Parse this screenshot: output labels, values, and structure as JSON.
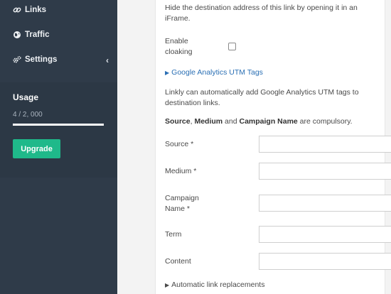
{
  "sidebar": {
    "nav": [
      {
        "label": "Links",
        "icon": "link-icon"
      },
      {
        "label": "Traffic",
        "icon": "globe-icon"
      },
      {
        "label": "Settings",
        "icon": "gears-icon"
      }
    ],
    "settings_chevron": "‹",
    "usage": {
      "title": "Usage",
      "count": "4 / 2, 000",
      "progress_fraction": 0.002
    },
    "upgrade_label": "Upgrade"
  },
  "form": {
    "hide_desc": "Hide the destination address of this link by opening it in an iFrame.",
    "cloaking_label": "Enable cloaking",
    "cloaking_checked": false,
    "utm_toggle": "Google Analytics UTM Tags",
    "utm_desc": "Linkly can automatically add Google Analytics UTM tags to destination links.",
    "compulsory": {
      "source": "Source",
      "sep1": ", ",
      "medium": "Medium",
      "and": " and ",
      "campaign": "Campaign Name",
      "rest": " are compulsory."
    },
    "fields": [
      {
        "label": "Source *",
        "value": ""
      },
      {
        "label": "Medium *",
        "value": ""
      },
      {
        "label": "Campaign Name *",
        "value": ""
      },
      {
        "label": "Term",
        "value": ""
      },
      {
        "label": "Content",
        "value": ""
      }
    ],
    "auto_replacements": "Automatic link replacements"
  },
  "colors": {
    "sidebar_bg": "#2f3b49",
    "upgrade_green": "#1fb98a",
    "link_blue": "#2a6fb4"
  }
}
